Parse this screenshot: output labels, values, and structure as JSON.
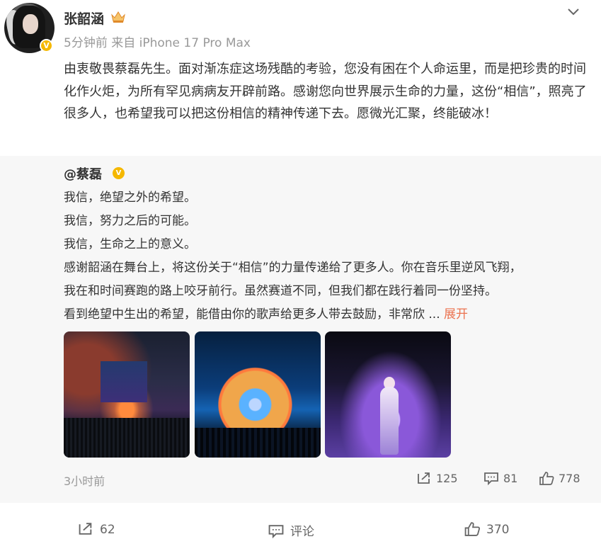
{
  "post": {
    "username": "张韶涵",
    "time": "5分钟前",
    "source": "来自 iPhone 17 Pro Max",
    "content": "由衷敬畏蔡磊先生。面对渐冻症这场残酷的考验，您没有困在个人命运里，而是把珍贵的时间化作火炬，为所有罕见病病友开辟前路。感谢您向世界展示生命的力量，这份“相信”，照亮了很多人，也希望我可以把这份相信的精神传递下去。愿微光汇聚，终能破冰！"
  },
  "repost": {
    "author": "@蔡磊",
    "lines": [
      "我信，绝望之外的希望。",
      "我信，努力之后的可能。",
      "我信，生命之上的意义。",
      "感谢韶涵在舞台上，将这份关于“相信”的力量传递给了更多人。你在音乐里逆风飞翔，",
      "我在和时间赛跑的路上咬牙前行。虽然赛道不同，但我们都在践行着同一份坚持。",
      "看到绝望中生出的希望，能借由你的歌声给更多人带去鼓励，非常欣 ..."
    ],
    "expand_label": "展开",
    "time": "3小时前",
    "reposts": "125",
    "comments": "81",
    "likes": "778"
  },
  "actions": {
    "repost_count": "62",
    "comment_label": "评论",
    "like_count": "370"
  },
  "icons": {
    "verified": "verified-badge-icon",
    "level": "crown-level-icon",
    "menu": "chevron-down-icon",
    "repost": "repost-icon",
    "comment": "comment-icon",
    "like": "thumbs-up-icon"
  },
  "colors": {
    "accent": "#eb7350",
    "verified": "#f5b800",
    "repost_bg": "#f7f7f7"
  }
}
